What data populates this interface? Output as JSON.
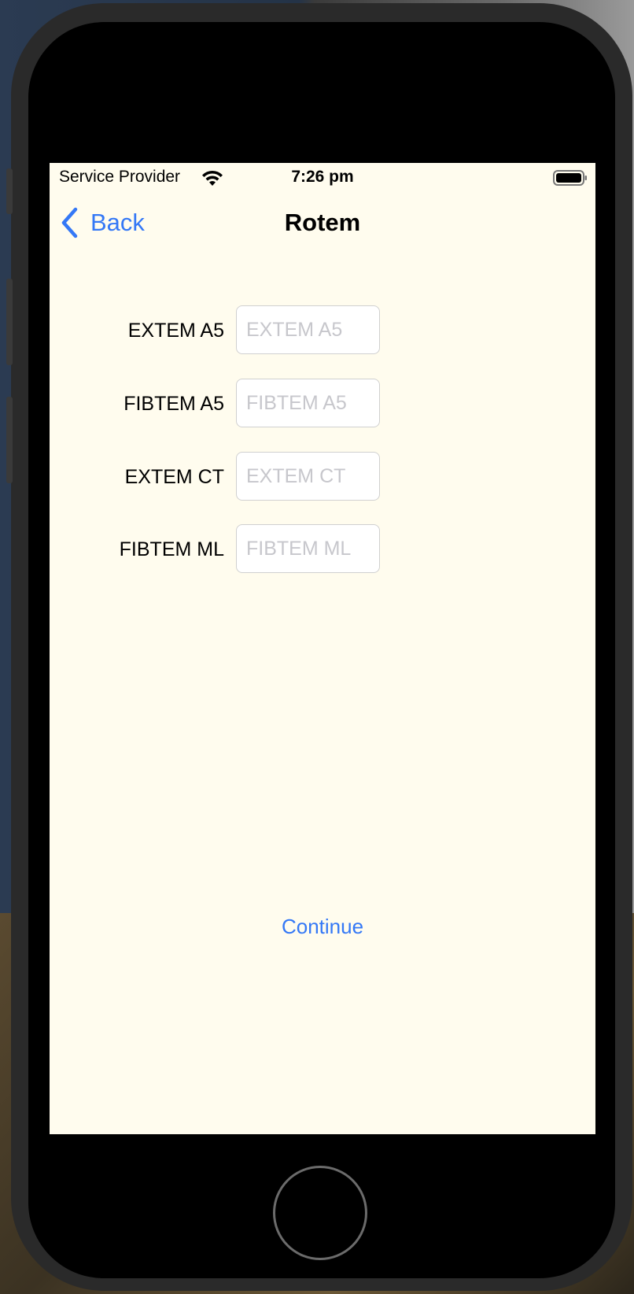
{
  "status_bar": {
    "carrier": "Service Provider",
    "time": "7:26 pm",
    "wifi_icon": "wifi-icon",
    "battery_icon": "battery-icon"
  },
  "nav_bar": {
    "back_label": "Back",
    "back_icon": "chevron-left-icon",
    "title": "Rotem"
  },
  "form": {
    "fields": [
      {
        "label": "EXTEM A5",
        "placeholder": "EXTEM A5",
        "value": ""
      },
      {
        "label": "FIBTEM A5",
        "placeholder": "FIBTEM A5",
        "value": ""
      },
      {
        "label": "EXTEM CT",
        "placeholder": "EXTEM CT",
        "value": ""
      },
      {
        "label": "FIBTEM ML",
        "placeholder": "FIBTEM ML",
        "value": ""
      }
    ]
  },
  "actions": {
    "continue_label": "Continue"
  },
  "colors": {
    "accent": "#3478f6",
    "screen_background": "#fffcee",
    "placeholder": "#c7c7cc"
  }
}
